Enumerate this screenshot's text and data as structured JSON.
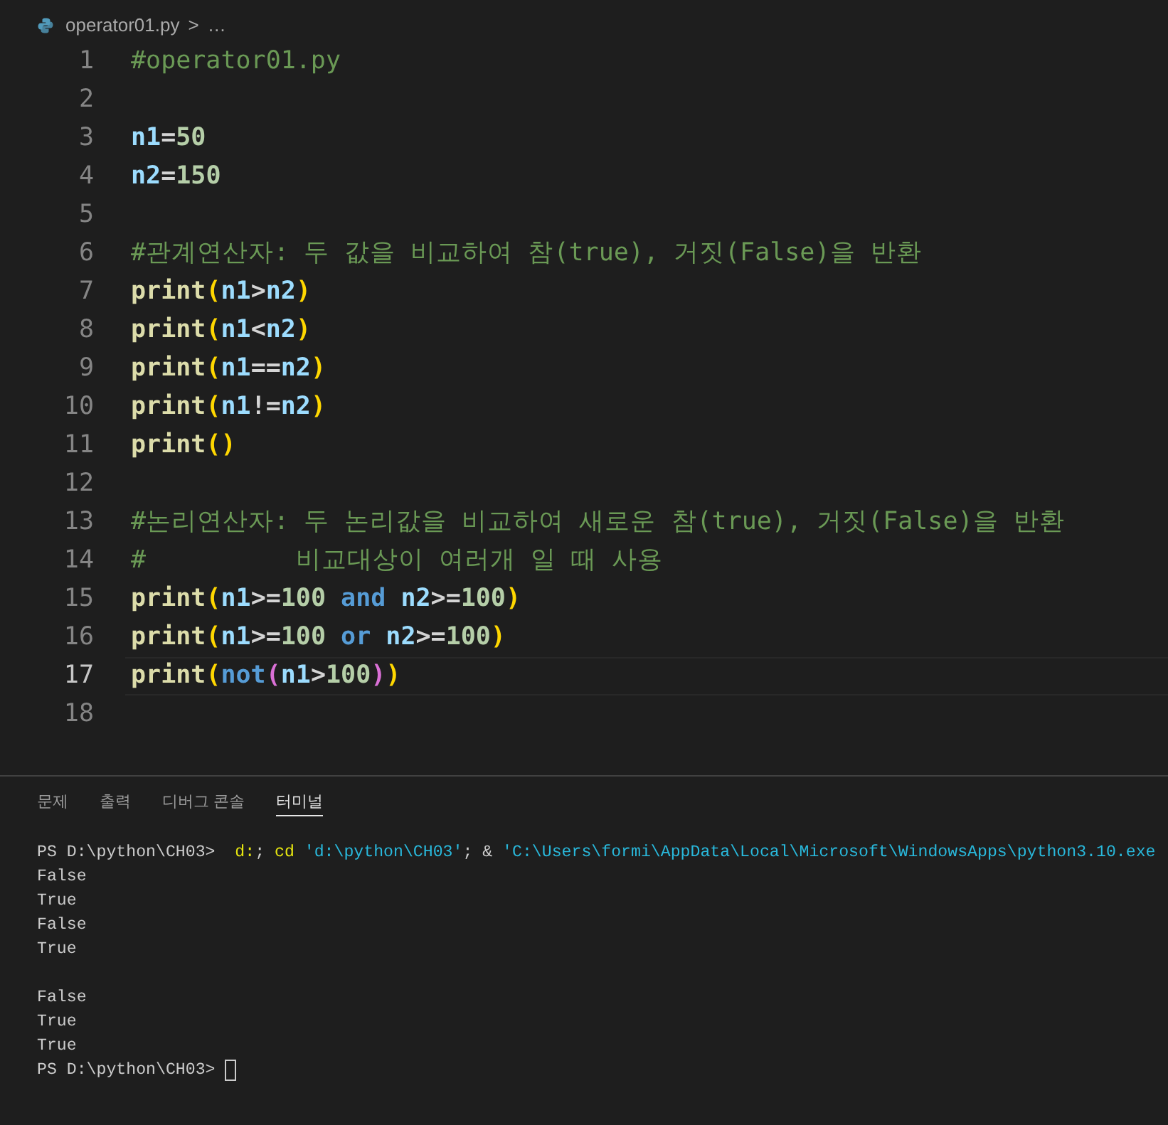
{
  "breadcrumb": {
    "file": "operator01.py",
    "separator": ">",
    "more": "…"
  },
  "editor": {
    "lines": [
      {
        "number": "1",
        "current": false,
        "tokens": [
          {
            "kind": "comment",
            "text": "#operator01.py"
          }
        ]
      },
      {
        "number": "2",
        "current": false
      },
      {
        "number": "3",
        "current": false,
        "tokens": [
          {
            "kind": "var",
            "text": "n1"
          },
          {
            "kind": "op",
            "text": "="
          },
          {
            "kind": "num",
            "text": "50"
          }
        ]
      },
      {
        "number": "4",
        "current": false,
        "tokens": [
          {
            "kind": "var",
            "text": "n2"
          },
          {
            "kind": "op",
            "text": "="
          },
          {
            "kind": "num",
            "text": "150"
          }
        ]
      },
      {
        "number": "5",
        "current": false
      },
      {
        "number": "6",
        "current": false,
        "tokens": [
          {
            "kind": "comment",
            "text": "#관계연산자: 두 값을 비교하여 참(true), 거짓(False)을 반환"
          }
        ]
      },
      {
        "number": "7",
        "current": false,
        "tokens": [
          {
            "kind": "func",
            "text": "print"
          },
          {
            "kind": "paren1",
            "text": "("
          },
          {
            "kind": "var",
            "text": "n1"
          },
          {
            "kind": "op",
            "text": ">"
          },
          {
            "kind": "var",
            "text": "n2"
          },
          {
            "kind": "paren1",
            "text": ")"
          }
        ]
      },
      {
        "number": "8",
        "current": false,
        "tokens": [
          {
            "kind": "func",
            "text": "print"
          },
          {
            "kind": "paren1",
            "text": "("
          },
          {
            "kind": "var",
            "text": "n1"
          },
          {
            "kind": "op",
            "text": "<"
          },
          {
            "kind": "var",
            "text": "n2"
          },
          {
            "kind": "paren1",
            "text": ")"
          }
        ]
      },
      {
        "number": "9",
        "current": false,
        "tokens": [
          {
            "kind": "func",
            "text": "print"
          },
          {
            "kind": "paren1",
            "text": "("
          },
          {
            "kind": "var",
            "text": "n1"
          },
          {
            "kind": "op",
            "text": "=="
          },
          {
            "kind": "var",
            "text": "n2"
          },
          {
            "kind": "paren1",
            "text": ")"
          }
        ]
      },
      {
        "number": "10",
        "current": false,
        "tokens": [
          {
            "kind": "func",
            "text": "print"
          },
          {
            "kind": "paren1",
            "text": "("
          },
          {
            "kind": "var",
            "text": "n1"
          },
          {
            "kind": "op",
            "text": "!="
          },
          {
            "kind": "var",
            "text": "n2"
          },
          {
            "kind": "paren1",
            "text": ")"
          }
        ]
      },
      {
        "number": "11",
        "current": false,
        "tokens": [
          {
            "kind": "func",
            "text": "print"
          },
          {
            "kind": "paren1",
            "text": "()"
          }
        ]
      },
      {
        "number": "12",
        "current": false
      },
      {
        "number": "13",
        "current": false,
        "tokens": [
          {
            "kind": "comment",
            "text": "#논리연산자: 두 논리값을 비교하여 새로운 참(true), 거짓(False)을 반환"
          }
        ]
      },
      {
        "number": "14",
        "current": false,
        "tokens": [
          {
            "kind": "comment",
            "text": "#          비교대상이 여러개 일 때 사용"
          }
        ]
      },
      {
        "number": "15",
        "current": false,
        "tokens": [
          {
            "kind": "func",
            "text": "print"
          },
          {
            "kind": "paren1",
            "text": "("
          },
          {
            "kind": "var",
            "text": "n1"
          },
          {
            "kind": "op",
            "text": ">="
          },
          {
            "kind": "num",
            "text": "100 "
          },
          {
            "kind": "keyword",
            "text": "and "
          },
          {
            "kind": "var",
            "text": "n2"
          },
          {
            "kind": "op",
            "text": ">="
          },
          {
            "kind": "num",
            "text": "100"
          },
          {
            "kind": "paren1",
            "text": ")"
          }
        ]
      },
      {
        "number": "16",
        "current": false,
        "tokens": [
          {
            "kind": "func",
            "text": "print"
          },
          {
            "kind": "paren1",
            "text": "("
          },
          {
            "kind": "var",
            "text": "n1"
          },
          {
            "kind": "op",
            "text": ">="
          },
          {
            "kind": "num",
            "text": "100 "
          },
          {
            "kind": "keyword",
            "text": "or "
          },
          {
            "kind": "var",
            "text": "n2"
          },
          {
            "kind": "op",
            "text": ">="
          },
          {
            "kind": "num",
            "text": "100"
          },
          {
            "kind": "paren1",
            "text": ")"
          }
        ]
      },
      {
        "number": "17",
        "current": true,
        "tokens": [
          {
            "kind": "func",
            "text": "print"
          },
          {
            "kind": "paren1",
            "text": "("
          },
          {
            "kind": "keyword",
            "text": "not"
          },
          {
            "kind": "paren2",
            "text": "("
          },
          {
            "kind": "var",
            "text": "n1"
          },
          {
            "kind": "op",
            "text": ">"
          },
          {
            "kind": "num",
            "text": "100"
          },
          {
            "kind": "paren2",
            "text": ")"
          },
          {
            "kind": "paren1",
            "text": ")"
          }
        ]
      },
      {
        "number": "18",
        "current": false
      }
    ]
  },
  "panel": {
    "tabs": [
      {
        "label": "문제",
        "selected": false
      },
      {
        "label": "출력",
        "selected": false
      },
      {
        "label": "디버그 콘솔",
        "selected": false
      },
      {
        "label": "터미널",
        "selected": true
      }
    ],
    "terminal": [
      {
        "tokens": [
          {
            "kind": "text",
            "text": "PS D:\\python\\CH03>  "
          },
          {
            "kind": "cmd",
            "text": "d:"
          },
          {
            "kind": "text",
            "text": "; "
          },
          {
            "kind": "cmd",
            "text": "cd "
          },
          {
            "kind": "str",
            "text": "'d:\\python\\CH03'"
          },
          {
            "kind": "text",
            "text": "; & "
          },
          {
            "kind": "str",
            "text": "'C:\\Users\\formi\\AppData\\Local\\Microsoft\\WindowsApps\\python3.10.exe"
          }
        ]
      },
      {
        "tokens": [
          {
            "kind": "text",
            "text": "False"
          }
        ]
      },
      {
        "tokens": [
          {
            "kind": "text",
            "text": "True"
          }
        ]
      },
      {
        "tokens": [
          {
            "kind": "text",
            "text": "False"
          }
        ]
      },
      {
        "tokens": [
          {
            "kind": "text",
            "text": "True"
          }
        ]
      },
      {
        "blank_line_before": true,
        "tokens": [
          {
            "kind": "text",
            "text": "False"
          }
        ]
      },
      {
        "tokens": [
          {
            "kind": "text",
            "text": "True"
          }
        ]
      },
      {
        "tokens": [
          {
            "kind": "text",
            "text": "True"
          }
        ]
      },
      {
        "tokens": [
          {
            "kind": "text",
            "text": "PS D:\\python\\CH03> "
          }
        ],
        "cursor": true
      }
    ]
  }
}
